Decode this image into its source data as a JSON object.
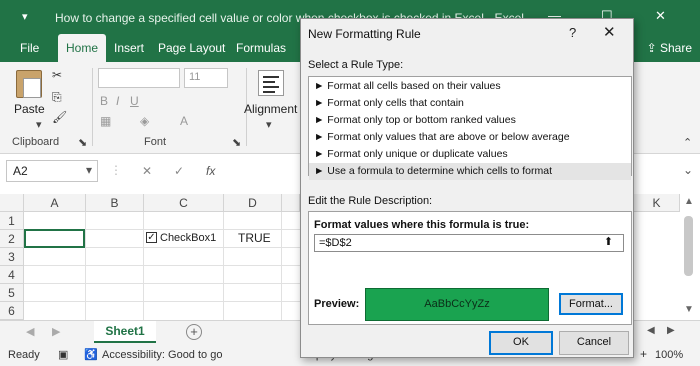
{
  "window": {
    "quick_access": "▾",
    "title": "How to change a specified cell value or color when checkbox is checked in Excel - Excel",
    "minimize": "—",
    "maximize": "☐",
    "close": "✕"
  },
  "ribbon_tabs": [
    "File",
    "Home",
    "Insert",
    "Page Layout",
    "Formulas"
  ],
  "share_label": "Share",
  "ribbon": {
    "paste_label": "Paste",
    "clipboard_label": "Clipboard",
    "font_label": "Font",
    "alignment_label": "Alignment",
    "font_size": "11"
  },
  "formula_bar": {
    "name_box": "A2",
    "cancel": "✕",
    "enter": "✓",
    "fx": "fx"
  },
  "grid": {
    "columns": [
      "A",
      "B",
      "C",
      "D"
    ],
    "far_column": "K",
    "rows": [
      "1",
      "2",
      "3",
      "4",
      "5",
      "6"
    ],
    "checkbox_label": "CheckBox1",
    "d2_value": "TRUE"
  },
  "sheet_tab": "Sheet1",
  "add_sheet": "+",
  "status": {
    "ready": "Ready",
    "accessibility": "Accessibility: Good to go",
    "display_settings": "Display Settings",
    "zoom": "100%",
    "zoom_minus": "−",
    "zoom_plus": "+"
  },
  "dialog": {
    "title": "New Formatting Rule",
    "help": "?",
    "close": "✕",
    "select_rule_type_label": "Select a Rule Type:",
    "rule_types": [
      "► Format all cells based on their values",
      "► Format only cells that contain",
      "► Format only top or bottom ranked values",
      "► Format only values that are above or below average",
      "► Format only unique or duplicate values",
      "► Use a formula to determine which cells to format"
    ],
    "selected_rule_index": 5,
    "edit_rule_label": "Edit the Rule Description:",
    "formula_label": "Format values where this formula is true:",
    "formula_value": "=$D$2",
    "collapse_icon": "⬆",
    "preview_label": "Preview:",
    "preview_text": "AaBbCcYyZz",
    "preview_color": "#1aa350",
    "format_button": "Format...",
    "ok_button": "OK",
    "cancel_button": "Cancel"
  },
  "colors": {
    "excel_green": "#217346",
    "focus_blue": "#0078d7"
  }
}
